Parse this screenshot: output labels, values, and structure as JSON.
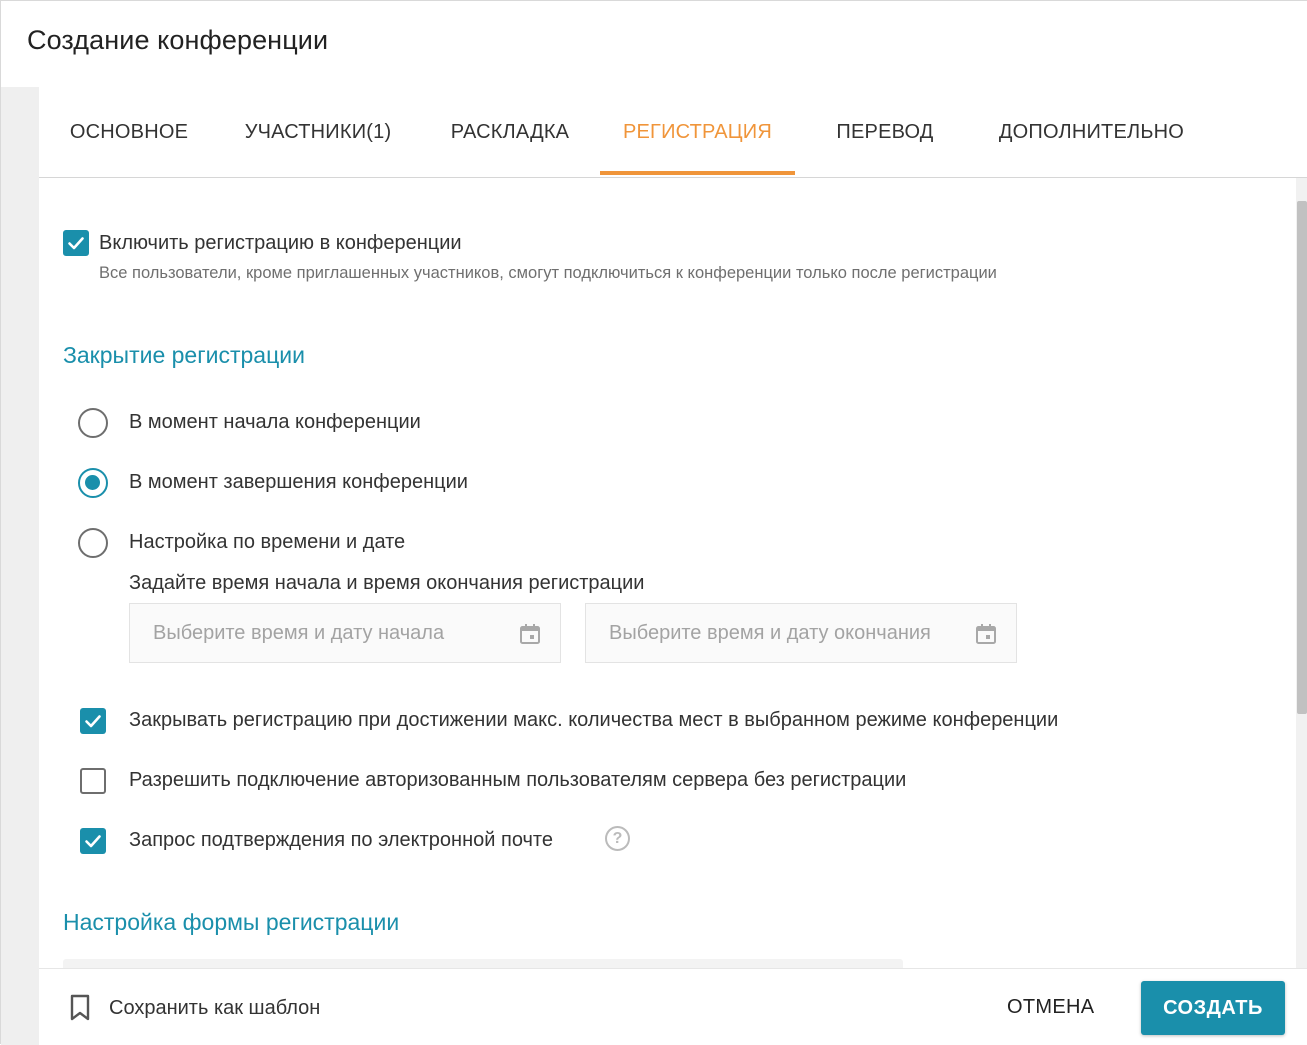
{
  "dialog": {
    "title": "Создание конференции"
  },
  "tabs": [
    {
      "label": "ОСНОВНОЕ",
      "active": false
    },
    {
      "label": "УЧАСТНИКИ(1)",
      "active": false
    },
    {
      "label": "РАСКЛАДКА",
      "active": false
    },
    {
      "label": "РЕГИСТРАЦИЯ",
      "active": true
    },
    {
      "label": "ПЕРЕВОД",
      "active": false
    },
    {
      "label": "ДОПОЛНИТЕЛЬНО",
      "active": false
    }
  ],
  "registration": {
    "enable": {
      "checked": true,
      "label": "Включить регистрацию в конференции",
      "description": "Все пользователи, кроме приглашенных участников, смогут подключиться к конференции только после регистрации"
    },
    "closing_section_title": "Закрытие регистрации",
    "closing_options": [
      {
        "label": "В момент начала конференции",
        "selected": false
      },
      {
        "label": "В момент завершения конференции",
        "selected": true
      },
      {
        "label": "Настройка по времени и дате",
        "selected": false
      }
    ],
    "time_range_hint": "Задайте время начала и время окончания регистрации",
    "start_field": {
      "placeholder": "Выберите время и дату начала",
      "icon": "calendar-icon"
    },
    "end_field": {
      "placeholder": "Выберите время и дату окончания",
      "icon": "calendar-icon"
    },
    "checkboxes": [
      {
        "label": "Закрывать регистрацию при достижении макс. количества мест в выбранном режиме конференции",
        "checked": true
      },
      {
        "label": "Разрешить подключение авторизованным пользователям сервера без регистрации",
        "checked": false
      },
      {
        "label": "Запрос подтверждения по электронной почте",
        "checked": true,
        "help_icon": "?"
      }
    ],
    "form_section_title": "Настройка формы регистрации"
  },
  "footer": {
    "save_template_label": "Сохранить как шаблон",
    "cancel_label": "ОТМЕНА",
    "create_label": "СОЗДАТЬ"
  },
  "colors": {
    "accent": "#1a8fab",
    "active_tab": "#f0953a"
  }
}
